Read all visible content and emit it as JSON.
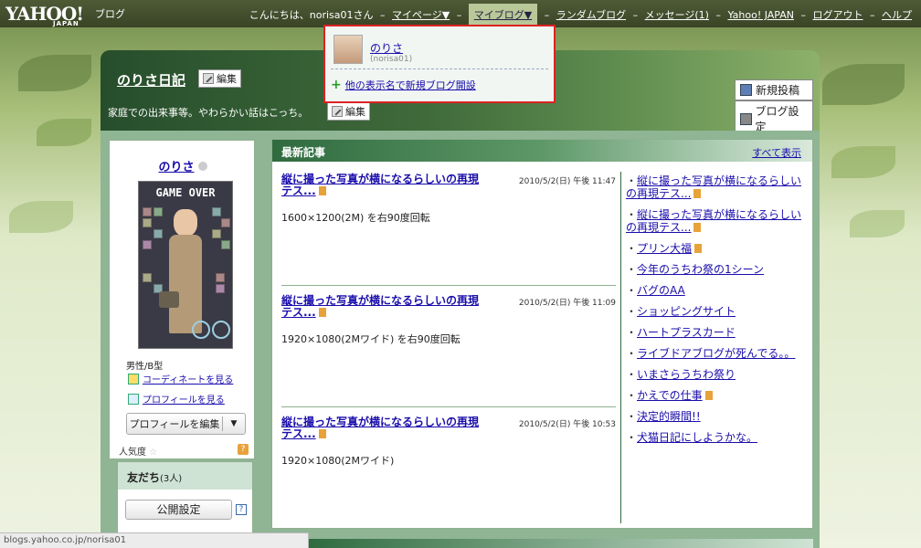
{
  "topbar": {
    "logo": "YAHOO!",
    "logo_sub": "JAPAN",
    "logo_blog": "ブログ",
    "greeting": "こんにちは、norisa01さん",
    "nav": [
      "マイページ▼",
      "マイブログ▼",
      "ランダムブログ",
      "メッセージ(1)",
      "Yahoo! JAPAN",
      "ログアウト",
      "ヘルプ"
    ],
    "separator": "–"
  },
  "dropdown": {
    "name": "のりさ",
    "id": "(norisa01)",
    "new_blog": "他の表示名で新規ブログ開設"
  },
  "header": {
    "title": "のりさ日記",
    "edit": "編集",
    "subtitle": "家庭での出来事等。やわらかい話はこっち。",
    "edit2": "編集",
    "new_post": "新規投稿",
    "settings": "ブログ設定"
  },
  "profile": {
    "name": "のりさ",
    "avatar_text": "GAME OVER",
    "meta": "男性/B型",
    "coordinate": "コーディネートを見る",
    "view_profile": "プロフィールを見る",
    "edit_profile": "プロフィールを編集",
    "popularity": "人気度",
    "help": "?"
  },
  "friends": {
    "title": "友だち",
    "count": "(3人)",
    "public": "公開設定",
    "help": "?"
  },
  "recent": {
    "title": "最新記事",
    "all": "すべて表示",
    "posts": [
      {
        "title": "縦に撮った写真が横になるらしいの再現テス...",
        "date": "2010/5/2(日) 午後 11:47",
        "body": "1600×1200(2M) を右90度回転"
      },
      {
        "title": "縦に撮った写真が横になるらしいの再現テス...",
        "date": "2010/5/2(日) 午後 11:09",
        "body": "1920×1080(2Mワイド) を右90度回転"
      },
      {
        "title": "縦に撮った写真が横になるらしいの再現テス...",
        "date": "2010/5/2(日) 午後 10:53",
        "body": "1920×1080(2Mワイド)"
      }
    ],
    "side": [
      "縦に撮った写真が横になるらしいの再現テス...",
      "縦に撮った写真が横になるらしいの再現テス...",
      "プリン大福",
      "今年のうちわ祭の1シーン",
      "バグのAA",
      "ショッピングサイト",
      "ハートプラスカード",
      "ライブドアブログが死んでる。。",
      "いまさらうちわ祭り",
      "かえでの仕事",
      "決定的瞬間!!",
      "犬猫日記にしようかな。"
    ]
  },
  "statusbar": {
    "url": "blogs.yahoo.co.jp/norisa01"
  }
}
